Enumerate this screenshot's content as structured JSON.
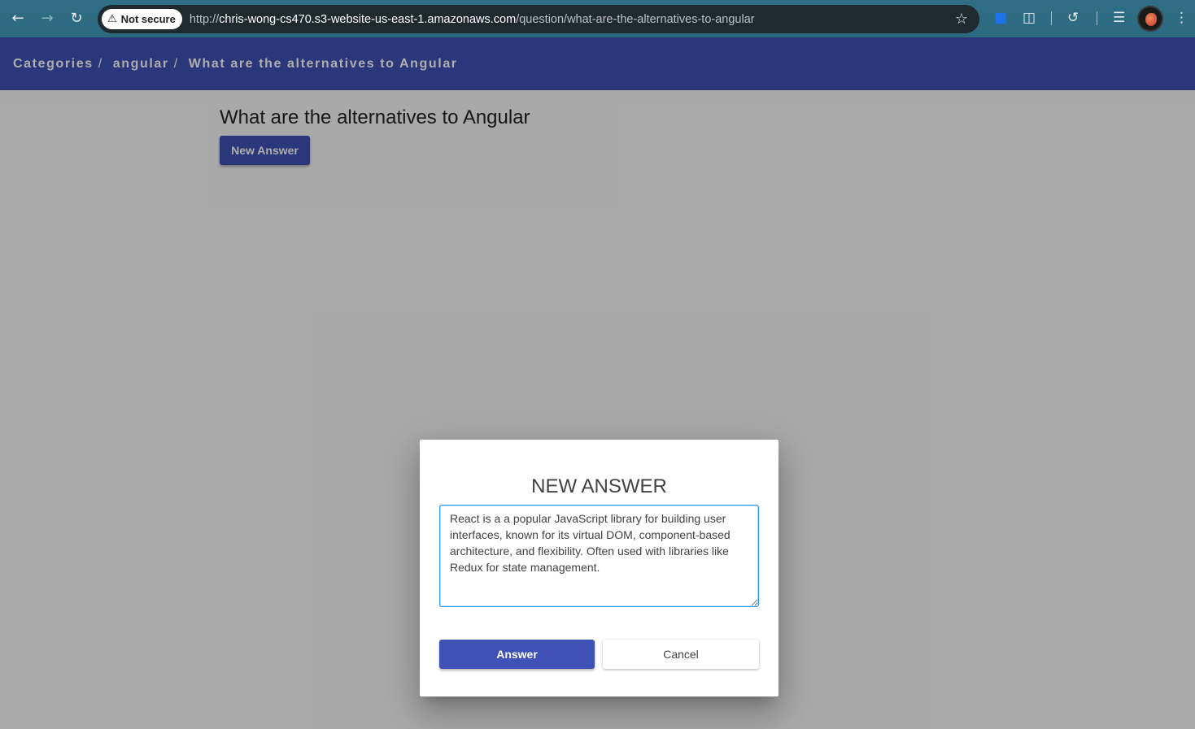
{
  "browser": {
    "security_label": "Not secure",
    "url_scheme": "http://",
    "url_host": "chris-wong-cs470.s3-website-us-east-1.amazonaws.com",
    "url_path": "/question/what-are-the-alternatives-to-angular"
  },
  "breadcrumb": {
    "items": [
      "Categories",
      "angular",
      "What are the alternatives to Angular"
    ],
    "separator": "/"
  },
  "question": {
    "title": "What are the alternatives to Angular",
    "new_answer_label": "New Answer"
  },
  "dialog": {
    "title": "NEW ANSWER",
    "answer_value": "React is a a popular JavaScript library for building user interfaces, known for its virtual DOM, component-based architecture, and flexibility. Often used with libraries like Redux for state management.",
    "submit_label": "Answer",
    "cancel_label": "Cancel"
  },
  "colors": {
    "primary": "#3f51b5",
    "focus": "#2196f3"
  },
  "icons": {
    "back": "arrow-left-icon",
    "forward": "arrow-right-icon",
    "reload": "reload-icon",
    "warning": "warning-icon",
    "bookmark": "star-icon",
    "extension": "puzzle-icon",
    "history": "history-icon",
    "media": "queue-music-icon",
    "menu": "more-vert-icon"
  }
}
